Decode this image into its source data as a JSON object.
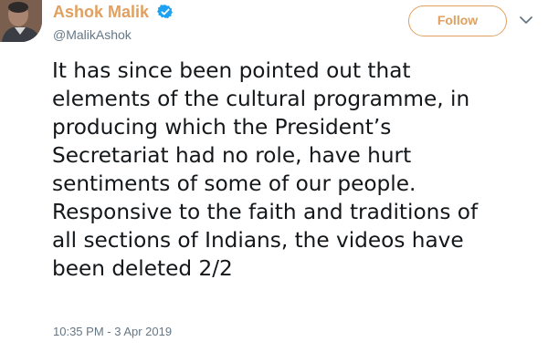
{
  "author": {
    "display_name": "Ashok Malik",
    "handle": "@MalikAshok",
    "verified": true,
    "avatar_icon": "profile-photo"
  },
  "actions": {
    "follow_label": "Follow",
    "more_icon": "chevron-down-icon"
  },
  "tweet": {
    "lines": [
      "It has since been pointed out that",
      "elements of the cultural programme, in",
      "producing which the President’s",
      "Secretariat had no role, have hurt",
      "sentiments of some of our people.",
      "Responsive to the faith and traditions of",
      "all sections of Indians, the videos have",
      "been deleted 2/2"
    ],
    "timestamp": "10:35 PM - 3 Apr 2019"
  },
  "colors": {
    "accent": "#e0a060",
    "verified": "#1da1f2",
    "text": "#14171a",
    "muted": "#657786"
  }
}
